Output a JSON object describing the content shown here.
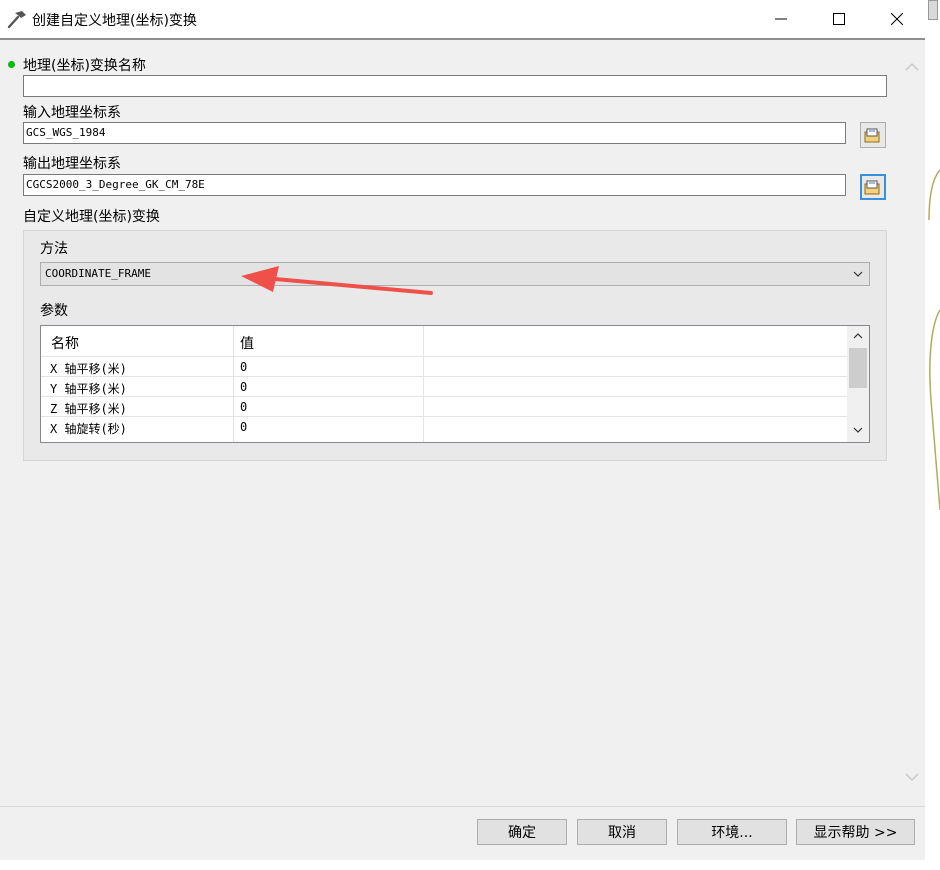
{
  "window": {
    "title": "创建自定义地理(坐标)变换",
    "icon": "hammer-icon",
    "minimize_glyph": "—",
    "maximize_glyph": "☐",
    "close_glyph": "✕"
  },
  "form": {
    "name_label": "地理(坐标)变换名称",
    "name_value": "",
    "required_indicator_color": "#00c000",
    "input_gcs_label": "输入地理坐标系",
    "input_gcs_value": "GCS_WGS_1984",
    "output_gcs_label": "输出地理坐标系",
    "output_gcs_value": "CGCS2000_3_Degree_GK_CM_78E",
    "custom_section_label": "自定义地理(坐标)变换",
    "method_label": "方法",
    "method_value": "COORDINATE_FRAME",
    "params_label": "参数",
    "params_table": {
      "headers": [
        "名称",
        "值"
      ],
      "rows": [
        {
          "name": "X 轴平移(米)",
          "value": "0"
        },
        {
          "name": "Y 轴平移(米)",
          "value": "0"
        },
        {
          "name": "Z 轴平移(米)",
          "value": "0"
        },
        {
          "name": "X 轴旋转(秒)",
          "value": "0"
        }
      ]
    }
  },
  "annotation": {
    "arrow_color": "#f0504a"
  },
  "buttons": {
    "ok": "确定",
    "cancel": "取消",
    "environments": "环境...",
    "show_help": "显示帮助 >>"
  }
}
